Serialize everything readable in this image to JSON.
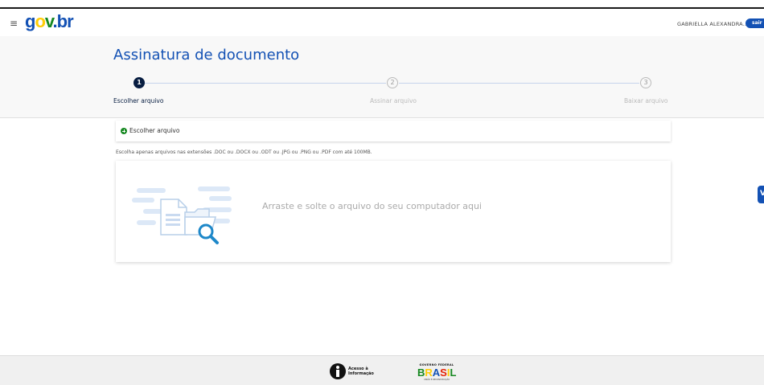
{
  "header": {
    "menu_icon": "hamburger-icon",
    "logo": {
      "g": "g",
      "o": "o",
      "v": "v",
      "dot": ".",
      "br": "br"
    },
    "user_name": "GABRIELLA ALEXANDRA...",
    "logout_label": "sair",
    "brand_color": "#1351b4"
  },
  "page": {
    "title": "Assinatura de documento"
  },
  "steps": [
    {
      "number": "1",
      "label": "Escolher arquivo",
      "state": "active"
    },
    {
      "number": "2",
      "label": "Assinar arquivo",
      "state": "inactive"
    },
    {
      "number": "3",
      "label": "Baixar arquivo",
      "state": "inactive"
    }
  ],
  "upload": {
    "choose_label": "Escolher arquivo",
    "choose_icon": "plus-circle-icon",
    "hint": "Escolha apenas arquivos nas extensões .DOC ou .DOCX ou .ODT ou .JPG ou .PNG ou .PDF com até 100MB.",
    "drop_text": "Arraste e solte o arquivo do seu computador aqui",
    "illustration_icon": "file-search-illustration"
  },
  "side_tab": {
    "label": "V"
  },
  "footer": {
    "acesso_line1": "Acesso à",
    "acesso_line2": "Informação",
    "brasil_top": "GOVERNO FEDERAL",
    "brasil_word": "BRASIL",
    "brasil_sub": "UNIÃO E RECONSTRUÇÃO"
  }
}
